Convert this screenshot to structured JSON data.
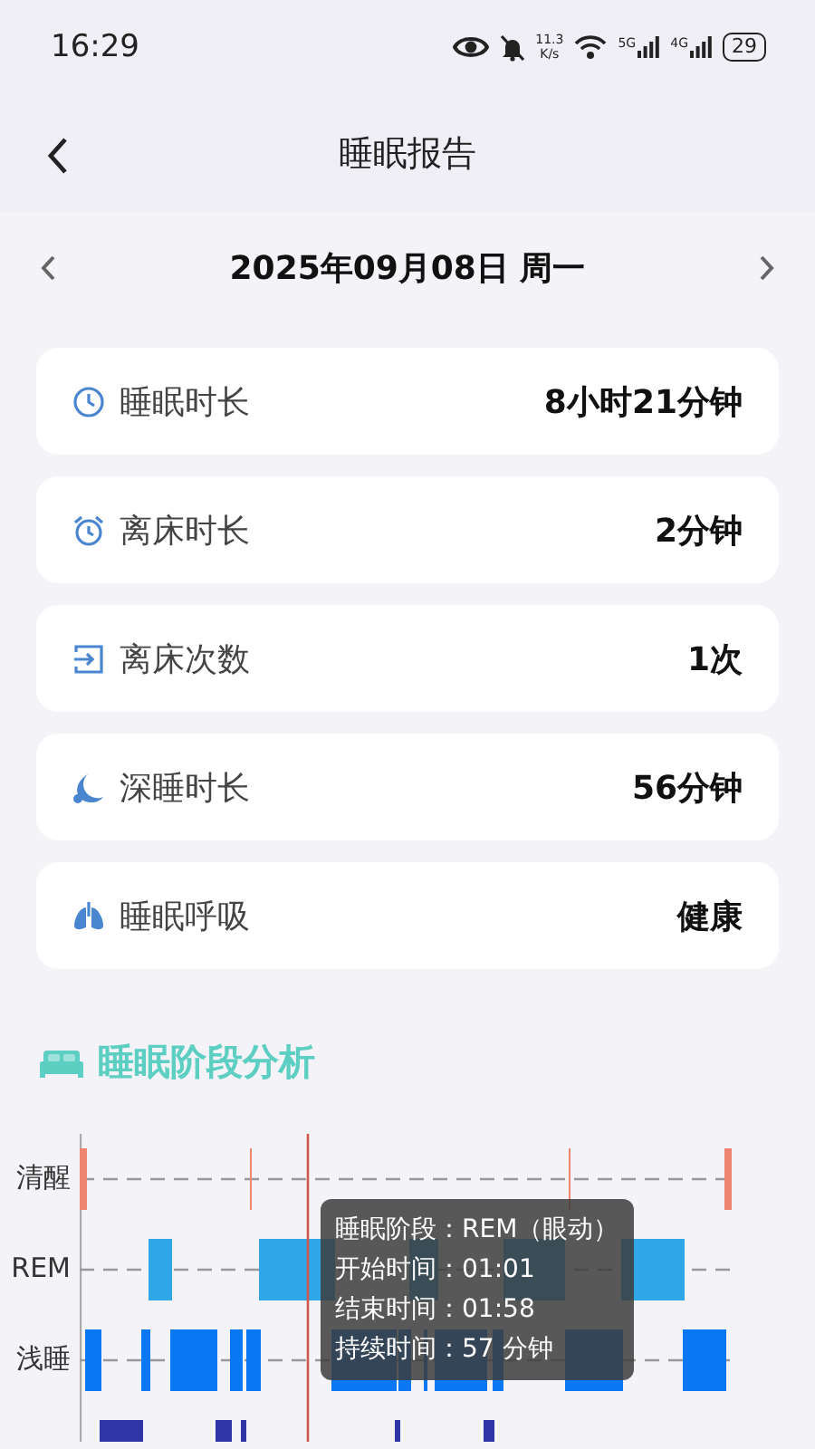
{
  "status_bar": {
    "time": "16:29",
    "net_speed_value": "11.3",
    "net_speed_unit": "K/s",
    "signal_1": "5G",
    "signal_2": "4G",
    "battery": "29"
  },
  "header": {
    "title": "睡眠报告"
  },
  "date_nav": {
    "date": "2025年09月08日 周一"
  },
  "metrics": [
    {
      "kind": "clock",
      "label": "睡眠时长",
      "value": "8小时21分钟"
    },
    {
      "kind": "alarm",
      "label": "离床时长",
      "value": "2分钟"
    },
    {
      "kind": "exit",
      "label": "离床次数",
      "value": "1次"
    },
    {
      "kind": "moon",
      "label": "深睡时长",
      "value": "56分钟"
    },
    {
      "kind": "lungs",
      "label": "睡眠呼吸",
      "value": "健康"
    }
  ],
  "stage_section": {
    "title": "睡眠阶段分析",
    "stage_labels": [
      "清醒",
      "REM",
      "浅睡"
    ],
    "tooltip": [
      "睡眠阶段：REM（眼动）",
      "开始时间：01:01",
      "结束时间：01:58",
      "持续时间：57 分钟"
    ]
  }
}
